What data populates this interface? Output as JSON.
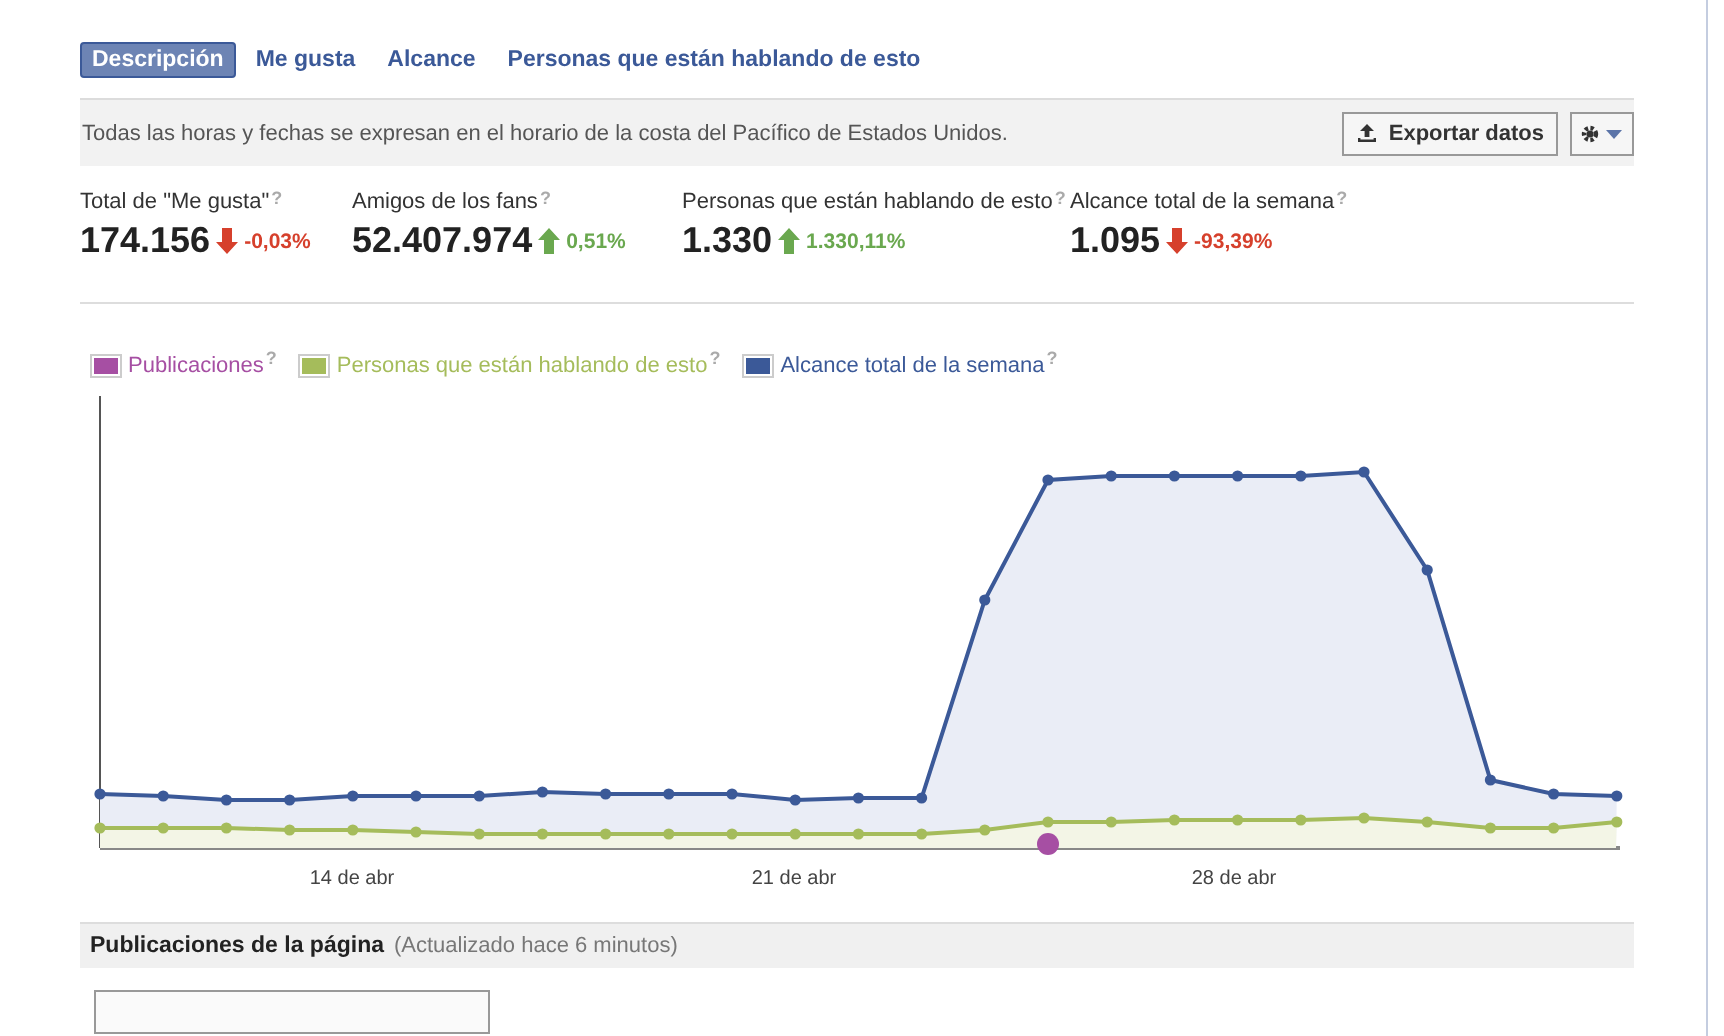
{
  "tabs": [
    {
      "label": "Descripción",
      "selected": true
    },
    {
      "label": "Me gusta",
      "selected": false
    },
    {
      "label": "Alcance",
      "selected": false
    },
    {
      "label": "Personas que están hablando de esto",
      "selected": false
    }
  ],
  "notice": "Todas las horas y fechas se expresan en el horario de la costa del Pacífico de Estados Unidos.",
  "export_button": "Exportar datos",
  "stats": [
    {
      "label": "Total de \"Me gusta\"",
      "help": "?",
      "value": "174.156",
      "rising": false,
      "change": "-0,03%"
    },
    {
      "label": "Amigos de los fans",
      "help": "?",
      "value": "52.407.974",
      "rising": true,
      "change": "0,51%"
    },
    {
      "label": "Personas que están hablando de esto",
      "help": "?",
      "value": "1.330",
      "rising": true,
      "change": "1.330,11%"
    },
    {
      "label": "Alcance total de la semana",
      "help": "?",
      "value": "1.095",
      "rising": false,
      "change": "-93,39%"
    }
  ],
  "legend": [
    {
      "label": "Publicaciones",
      "help": "?",
      "color": "#a64fa3"
    },
    {
      "label": "Personas que están hablando de esto",
      "help": "?",
      "color": "#a5bc5b"
    },
    {
      "label": "Alcance total de la semana",
      "help": "?",
      "color": "#3b5998"
    }
  ],
  "x_labels": [
    "14 de abr",
    "21 de abr",
    "28 de abr"
  ],
  "posts_section": {
    "title": "Publicaciones de la página",
    "note": "(Actualizado hace 6 minutos)"
  }
}
